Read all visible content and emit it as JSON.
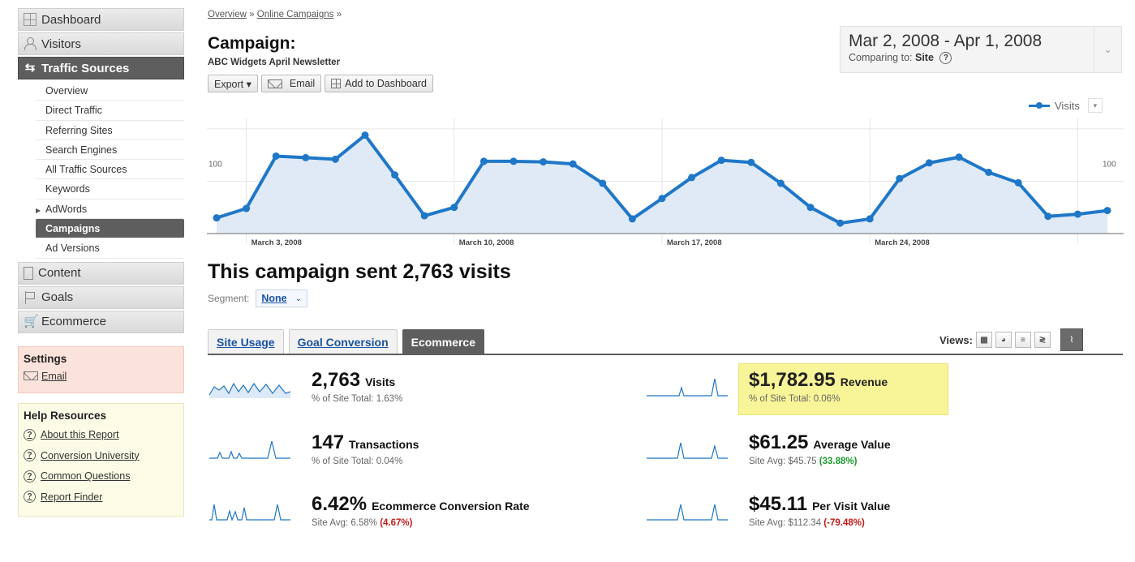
{
  "sidebar": {
    "nav": [
      {
        "label": "Dashboard",
        "icon": "grid-icon"
      },
      {
        "label": "Visitors",
        "icon": "person-icon"
      },
      {
        "label": "Traffic Sources",
        "icon": "arrows-icon",
        "active": true
      }
    ],
    "traffic_items": [
      "Overview",
      "Direct Traffic",
      "Referring Sites",
      "Search Engines",
      "All Traffic Sources",
      "Keywords",
      "AdWords",
      "Campaigns",
      "Ad Versions"
    ],
    "nav_bottom": [
      {
        "label": "Content",
        "icon": "document-icon"
      },
      {
        "label": "Goals",
        "icon": "flag-icon"
      },
      {
        "label": "Ecommerce",
        "icon": "cart-icon"
      }
    ],
    "settings": {
      "title": "Settings",
      "email": "Email"
    },
    "help": {
      "title": "Help Resources",
      "links": [
        "About this Report",
        "Conversion University",
        "Common Questions",
        "Report Finder"
      ]
    }
  },
  "header": {
    "breadcrumb": [
      "Overview",
      "Online Campaigns"
    ],
    "breadcrumb_sep": "»",
    "title": "Campaign:",
    "subtitle": "ABC Widgets April Newsletter",
    "toolbar": {
      "export": "Export ▾",
      "email": "Email",
      "add_dashboard": "Add to Dashboard"
    }
  },
  "date": {
    "range": "Mar 2, 2008 - Apr 1, 2008",
    "comparing_label": "Comparing to:",
    "comparing_value": "Site"
  },
  "legend": {
    "label": "Visits"
  },
  "chart_data": {
    "type": "line",
    "series": [
      {
        "name": "Visits",
        "color": "#1f77c8",
        "values": [
          30,
          48,
          148,
          145,
          142,
          188,
          112,
          34,
          50,
          138,
          138,
          137,
          133,
          96,
          28,
          67,
          107,
          140,
          136,
          96,
          50,
          20,
          28,
          105,
          135,
          146,
          117,
          97,
          33,
          37,
          44
        ]
      }
    ],
    "x_ticks": [
      "March 3, 2008",
      "March 10, 2008",
      "March 17, 2008",
      "March 24, 2008"
    ],
    "y_ticks": [
      100,
      200
    ],
    "ylim": [
      0,
      220
    ],
    "grid": true
  },
  "summary": {
    "headline": "This campaign sent 2,763 visits",
    "segment_label": "Segment:",
    "segment_value": "None"
  },
  "tabs": [
    "Site Usage",
    "Goal Conversion",
    "Ecommerce"
  ],
  "views_label": "Views:",
  "metrics": {
    "visits": {
      "value": "2,763",
      "label": "Visits",
      "sub": "% of Site Total: 1.63%"
    },
    "transactions": {
      "value": "147",
      "label": "Transactions",
      "sub": "% of Site Total: 0.04%"
    },
    "conversion": {
      "value": "6.42%",
      "label": "Ecommerce Conversion Rate",
      "sub": "Site Avg: 6.58%",
      "delta": "(4.67%)"
    },
    "revenue": {
      "value": "$1,782.95",
      "label": "Revenue",
      "sub": "% of Site Total: 0.06%"
    },
    "avg_value": {
      "value": "$61.25",
      "label": "Average Value",
      "sub": "Site Avg: $45.75",
      "delta": "(33.88%)"
    },
    "per_visit": {
      "value": "$45.11",
      "label": "Per Visit Value",
      "sub": "Site Avg: $112.34",
      "delta": "(-79.48%)"
    }
  }
}
